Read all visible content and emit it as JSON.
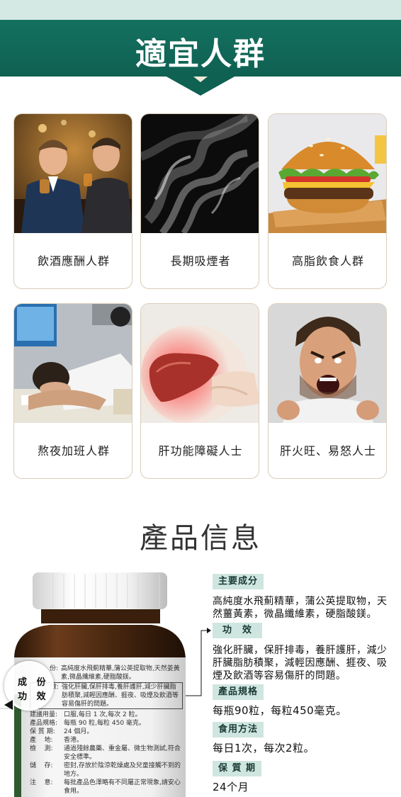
{
  "section1": {
    "title": "適宜人群"
  },
  "groups": [
    {
      "label": "飲酒應酬人群",
      "image": "drinking-men-photo"
    },
    {
      "label": "長期吸煙者",
      "image": "smoke-photo"
    },
    {
      "label": "高脂飲食人群",
      "image": "burger-photo"
    },
    {
      "label": "熬夜加班人群",
      "image": "overtime-worker-photo"
    },
    {
      "label": "肝功能障礙人士",
      "image": "liver-photo"
    },
    {
      "label": "肝火旺、易怒人士",
      "image": "angry-man-photo"
    }
  ],
  "section2": {
    "title": "產品信息"
  },
  "label_panel": {
    "ingredients_head": "份:",
    "ingredients_text": "高純度水飛薊精華,蒲公英提取物,天然姜黃素,微晶纖維素,硬脂酸鎂。",
    "efficacy_head": "效:",
    "efficacy_text": "強化肝臟,保肝排毒,養肝護肝,減少肝臟脂肪積聚,減輕因應酬、捱夜、吸煙及飲酒等容易傷肝的問題。",
    "magnifier_line1": "成   份",
    "magnifier_line2": "功   效",
    "rows": [
      {
        "k": "建議用量:",
        "v": "口服,每日 1 次,每次 2 粒。"
      },
      {
        "k": "產品規格:",
        "v": "每瓶 90 粒,每粒 450 毫克。"
      },
      {
        "k": "保 質 期:",
        "v": "24 個月。"
      },
      {
        "k": "產    地:",
        "v": "香港。"
      },
      {
        "k": "檢    測:",
        "v": "通過殘餘農藥、重金屬、微生物測試,符合安全標準。"
      },
      {
        "k": "儲    存:",
        "v": "密封,存放於陰涼乾燥處及兒童接觸不到的地方。"
      },
      {
        "k": "注    意:",
        "v": "每批產品色澤略有不同屬正常現象,請安心食用。"
      }
    ]
  },
  "info": {
    "ingredients": {
      "label": "主要成分",
      "text": "高純度水飛薊精華，蒲公英提取物，天然薑黃素，微晶纖維素，硬脂酸鎂。"
    },
    "efficacy": {
      "label": "功　效",
      "text": "強化肝臟，保肝排毒，養肝護肝，減少肝臟脂肪積聚，減輕因應酬、捱夜、吸煙及飲酒等容易傷肝的問題。"
    },
    "spec": {
      "label": "產品規格",
      "text": "每瓶90粒，每粒450毫克。"
    },
    "usage": {
      "label": "食用方法",
      "text": "每日1次，每次2粒。"
    },
    "shelf": {
      "label": "保 質 期",
      "text": "24个月"
    }
  },
  "colors": {
    "brand_green": "#0f6152",
    "tag_bg": "#cfe5e0",
    "card_border": "#d9cdb8"
  }
}
